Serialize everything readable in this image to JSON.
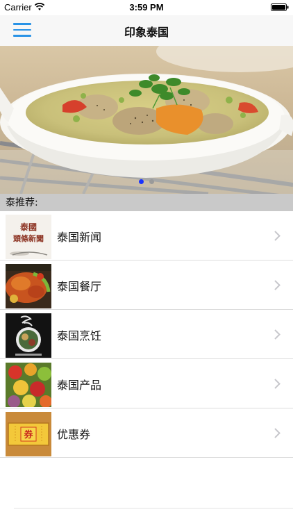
{
  "status_bar": {
    "carrier": "Carrier",
    "time": "3:59 PM",
    "wifi_icon": "wifi-icon",
    "battery_icon": "battery-full-icon"
  },
  "nav_bar": {
    "title": "印象泰国",
    "menu_icon": "hamburger-menu-icon",
    "accent_color": "#2a93e6"
  },
  "banner": {
    "image": "thai curry soup in white bowl",
    "page_count": 2,
    "active_page": 1,
    "active_dot_color": "#1a33ff"
  },
  "section": {
    "title": "泰推荐:"
  },
  "list": {
    "items": [
      {
        "label": "泰国新闻",
        "thumb_text_line1": "泰國",
        "thumb_text_line2": "頭條新聞"
      },
      {
        "label": "泰国餐厅"
      },
      {
        "label": "泰国烹饪"
      },
      {
        "label": "泰国产品"
      },
      {
        "label": "优惠券",
        "thumb_text": "券"
      }
    ]
  }
}
